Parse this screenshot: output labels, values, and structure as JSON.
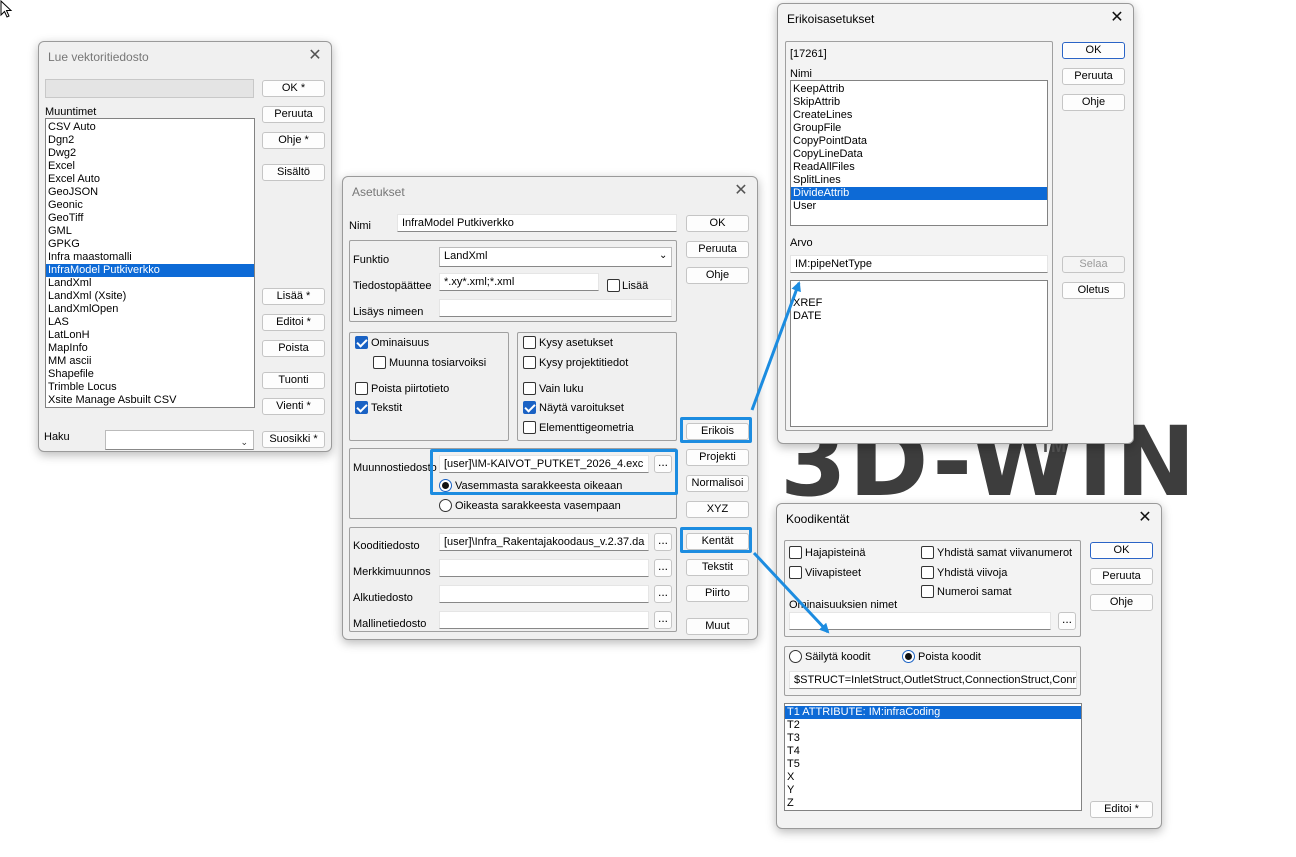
{
  "brand": {
    "logo_text": "3D-WIN",
    "tm": "TM"
  },
  "lue": {
    "title": "Lue vektoritiedosto",
    "muuntimet_label": "Muuntimet",
    "items": [
      "CSV Auto",
      "Dgn2",
      "Dwg2",
      "Excel",
      "Excel Auto",
      "GeoJSON",
      "Geonic",
      "GeoTiff",
      "GML",
      "GPKG",
      "Infra maastomalli",
      "InfraModel Putkiverkko",
      "LandXml",
      "LandXml (Xsite)",
      "LandXmlOpen",
      "LAS",
      "LatLonH",
      "MapInfo",
      "MM ascii",
      "Shapefile",
      "Trimble Locus",
      "Xsite Manage Asbuilt CSV"
    ],
    "selected": "InfraModel Putkiverkko",
    "ok": "OK *",
    "peruuta": "Peruuta",
    "ohje": "Ohje *",
    "sisalto": "Sisältö",
    "lisaa": "Lisää *",
    "editoi": "Editoi *",
    "poista": "Poista",
    "tuonti": "Tuonti",
    "vienti": "Vienti *",
    "haku_label": "Haku",
    "suosikki": "Suosikki *"
  },
  "asetukset": {
    "title": "Asetukset",
    "nimi_label": "Nimi",
    "nimi_value": "InfraModel Putkiverkko",
    "funktio_label": "Funktio",
    "funktio_value": "LandXml",
    "paate_label": "Tiedostopäättee",
    "paate_value": "*.xy*.xml;*.xml",
    "lisaa_cb": "Lisää",
    "lisays_label": "Lisäys nimeen",
    "lisays_value": "",
    "ominaisuus": "Ominaisuus",
    "muunna": "Muunna tosiarvoiksi",
    "poista_piirto": "Poista piirtotieto",
    "tekstit": "Tekstit",
    "kysy_asetukset": "Kysy asetukset",
    "kysy_projekti": "Kysy projektitiedot",
    "vain_luku": "Vain luku",
    "nayta_varoitukset": "Näytä varoitukset",
    "elementti": "Elementtigeometria",
    "muunnos_label": "Muunnostiedosto",
    "muunnos_value": "[user]\\IM-KAIVOT_PUTKET_2026_4.exc",
    "vasemmasta": "Vasemmasta sarakkeesta oikeaan",
    "oikeasta": "Oikeasta sarakkeesta vasempaan",
    "koodi_label": "Kooditiedosto",
    "koodi_value": "[user]\\Infra_Rakentajakoodaus_v.2.37.da",
    "merkki_label": "Merkkimuunnos",
    "alku_label": "Alkutiedosto",
    "malline_label": "Mallinetiedosto",
    "ok": "OK",
    "peruuta": "Peruuta",
    "ohje": "Ohje",
    "erikois": "Erikois",
    "projekti": "Projekti",
    "normalisoi": "Normalisoi",
    "xyz": "XYZ",
    "kentat": "Kentät",
    "teksti": "Tekstit",
    "piirto": "Piirto",
    "muut": "Muut",
    "dots": "..."
  },
  "erikois": {
    "title": "Erikoisasetukset",
    "id": "[17261]",
    "nimi_label": "Nimi",
    "items": [
      "KeepAttrib",
      "SkipAttrib",
      "CreateLines",
      "GroupFile",
      "CopyPointData",
      "CopyLineData",
      "ReadAllFiles",
      "SplitLines",
      "DivideAttrib",
      "User"
    ],
    "selected": "DivideAttrib",
    "arvo_label": "Arvo",
    "arvo_value": "IM:pipeNetType",
    "values": [
      "XREF",
      "DATE"
    ],
    "ok": "OK",
    "peruuta": "Peruuta",
    "ohje": "Ohje",
    "selaa": "Selaa",
    "oletus": "Oletus"
  },
  "koodi": {
    "title": "Koodikentät",
    "hajapisteina": "Hajapisteinä",
    "viivapisteet": "Viivapisteet",
    "yhdista_numerot": "Yhdistä samat viivanumerot",
    "yhdista_viivoja": "Yhdistä viivoja",
    "numeroi": "Numeroi samat",
    "ominaisuus_label": "Ominaisuuksien nimet",
    "sailyta": "Säilytä koodit",
    "poista": "Poista koodit",
    "struct_value": "$STRUCT=InletStruct,OutletStruct,ConnectionStruct,Conr",
    "items": [
      "T1  ATTRIBUTE: IM:infraCoding",
      "T2",
      "T3",
      "T4",
      "T5",
      "X",
      "Y",
      "Z"
    ],
    "ok": "OK",
    "peruuta": "Peruuta",
    "ohje": "Ohje",
    "editoi": "Editoi *",
    "dots": "..."
  }
}
